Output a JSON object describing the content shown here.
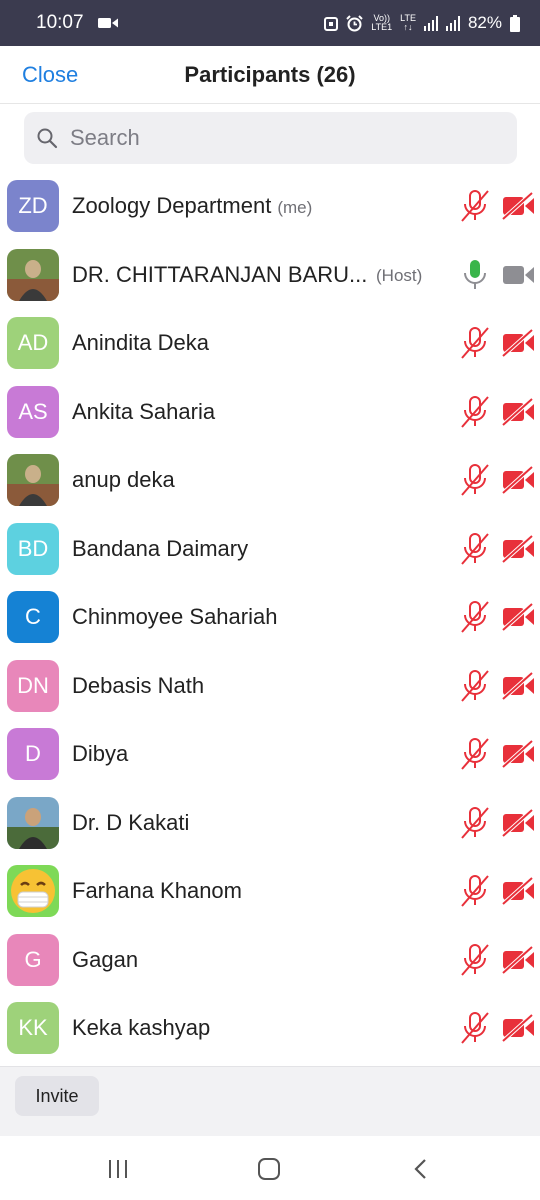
{
  "status_bar": {
    "time": "10:07",
    "battery": "82%",
    "network_top": "Vo))",
    "network_bottom": "LTE1",
    "lte_top": "LTE",
    "lte_bottom": "↑↓",
    "icons": [
      "video-camera-icon",
      "screenshot-lock-icon",
      "alarm-icon",
      "signal-icon",
      "battery-icon"
    ]
  },
  "header": {
    "close_label": "Close",
    "title": "Participants (26)"
  },
  "search": {
    "placeholder": "Search"
  },
  "participants": [
    {
      "name": "Zoology Department",
      "tag": "(me)",
      "initials": "ZD",
      "avatar_color": "#7b84cc",
      "mic": "muted",
      "video": "off"
    },
    {
      "name": "DR. CHITTARANJAN BARU...",
      "tag": "(Host)",
      "initials": "",
      "avatar_type": "photo",
      "mic": "on",
      "video": "on"
    },
    {
      "name": "Anindita Deka",
      "tag": "",
      "initials": "AD",
      "avatar_color": "#9ed27a",
      "mic": "muted",
      "video": "off"
    },
    {
      "name": "Ankita Saharia",
      "tag": "",
      "initials": "AS",
      "avatar_color": "#c87ad6",
      "mic": "muted",
      "video": "off"
    },
    {
      "name": "anup deka",
      "tag": "",
      "initials": "",
      "avatar_type": "photo",
      "mic": "muted",
      "video": "off"
    },
    {
      "name": "Bandana Daimary",
      "tag": "",
      "initials": "BD",
      "avatar_color": "#5dd1e0",
      "mic": "muted",
      "video": "off"
    },
    {
      "name": "Chinmoyee Sahariah",
      "tag": "",
      "initials": "C",
      "avatar_color": "#1582d4",
      "mic": "muted",
      "video": "off"
    },
    {
      "name": "Debasis Nath",
      "tag": "",
      "initials": "DN",
      "avatar_color": "#e887ba",
      "mic": "muted",
      "video": "off"
    },
    {
      "name": "Dibya",
      "tag": "",
      "initials": "D",
      "avatar_color": "#c87ad6",
      "mic": "muted",
      "video": "off"
    },
    {
      "name": "Dr. D Kakati",
      "tag": "",
      "initials": "",
      "avatar_type": "photo",
      "mic": "muted",
      "video": "off"
    },
    {
      "name": "Farhana Khanom",
      "tag": "",
      "initials": "",
      "avatar_type": "emoji",
      "mic": "muted",
      "video": "off"
    },
    {
      "name": "Gagan",
      "tag": "",
      "initials": "G",
      "avatar_color": "#e887ba",
      "mic": "muted",
      "video": "off"
    },
    {
      "name": "Keka kashyap",
      "tag": "",
      "initials": "KK",
      "avatar_color": "#9ed27a",
      "mic": "muted",
      "video": "off"
    }
  ],
  "bottom": {
    "invite_label": "Invite"
  },
  "nav": {
    "icons": [
      "recent-apps-icon",
      "home-icon",
      "back-icon"
    ]
  },
  "colors": {
    "accent": "#1f7fe0",
    "muted_red": "#e8303a",
    "mic_green": "#39b54a",
    "cam_gray": "#8e8e93"
  }
}
